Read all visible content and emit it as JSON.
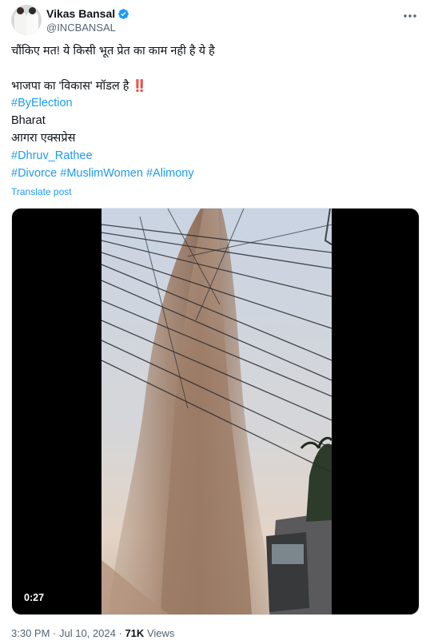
{
  "author": {
    "display_name": "Vikas Bansal",
    "handle": "@INCBANSAL"
  },
  "tweet": {
    "line1": "चौंकिए मत! ये किसी भूत प्रेत का काम नही है ये है",
    "line2": "भाजपा का 'विकास' मॉडल है",
    "line2_emoji": "‼️",
    "hashtag_byelection": "#ByElection",
    "text_bharat": "Bharat",
    "text_agra": "आगरा एक्सप्रेस",
    "hashtag_dhruv": "#Dhruv_Rathee",
    "hashtag_divorce": "#Divorce",
    "hashtag_muslimwomen": "#MuslimWomen",
    "hashtag_alimony": "#Alimony",
    "translate_label": "Translate post"
  },
  "video": {
    "timecode": "0:27",
    "description": "Water pipe burst shooting a tall column of muddy water into power lines"
  },
  "meta": {
    "time": "3:30 PM",
    "date": "Jul 10, 2024",
    "views_count": "71K",
    "views_label": "Views",
    "separator": "·"
  },
  "colors": {
    "link": "#1d9bf0",
    "verified": "#1d9bf0",
    "secondary_text": "#536471"
  },
  "icons": {
    "verified": "verified-badge-icon",
    "more": "more-options-icon"
  }
}
